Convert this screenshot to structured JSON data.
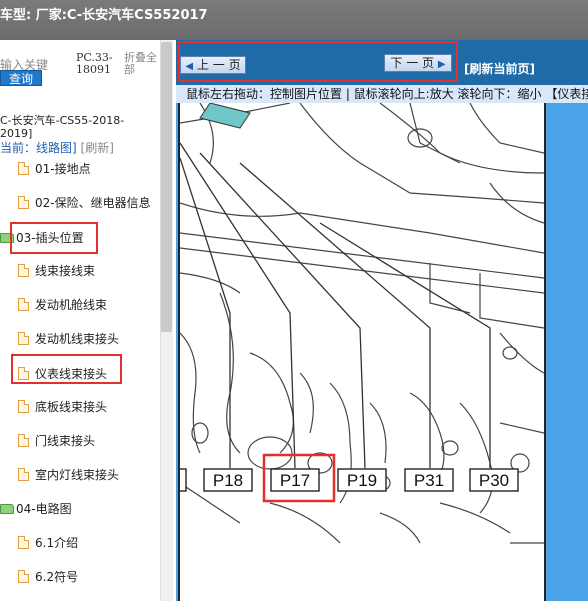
{
  "header": {
    "title": "车型:  厂家:C-长安汽车CS552017"
  },
  "sidebar": {
    "search_label": "输入关键",
    "search_button": "查询",
    "code_line1": "PC.33-",
    "code_line2": "18091",
    "fold_line1": "折叠全",
    "fold_line2": "部",
    "model": "C-长安汽车-CS55-2018-2019]",
    "current_label": "当前：线路图]",
    "current_refresh": "[刷新]",
    "items": [
      {
        "label": "01-接地点",
        "type": "doc"
      },
      {
        "label": "02-保险、继电器信息",
        "type": "doc"
      },
      {
        "label": "03-插头位置",
        "type": "folder"
      },
      {
        "label": "线束接线束",
        "type": "doc"
      },
      {
        "label": "发动机舱线束",
        "type": "doc"
      },
      {
        "label": "发动机线束接头",
        "type": "doc"
      },
      {
        "label": "仪表线束接头",
        "type": "doc"
      },
      {
        "label": "底板线束接头",
        "type": "doc"
      },
      {
        "label": "门线束接头",
        "type": "doc"
      },
      {
        "label": "室内灯线束接头",
        "type": "doc"
      },
      {
        "label": "04-电路图",
        "type": "folder"
      },
      {
        "label": "6.1介绍",
        "type": "doc"
      },
      {
        "label": "6.2符号",
        "type": "doc"
      }
    ]
  },
  "viewer": {
    "prev_button": "上 一 页",
    "next_button": "下 一 页",
    "refresh_page": "[刷新当前页]",
    "hint": "鼠标左右拖动：控制图片位置 | 鼠标滚轮向上:放大  滚轮向下：缩小 【仪表接",
    "labels": [
      "P18",
      "P17",
      "P19",
      "P31",
      "P30"
    ]
  },
  "colors": {
    "nav_bg": "#1e6ba8",
    "highlight": "#e03030",
    "hint_bg": "#d8e7fa"
  }
}
